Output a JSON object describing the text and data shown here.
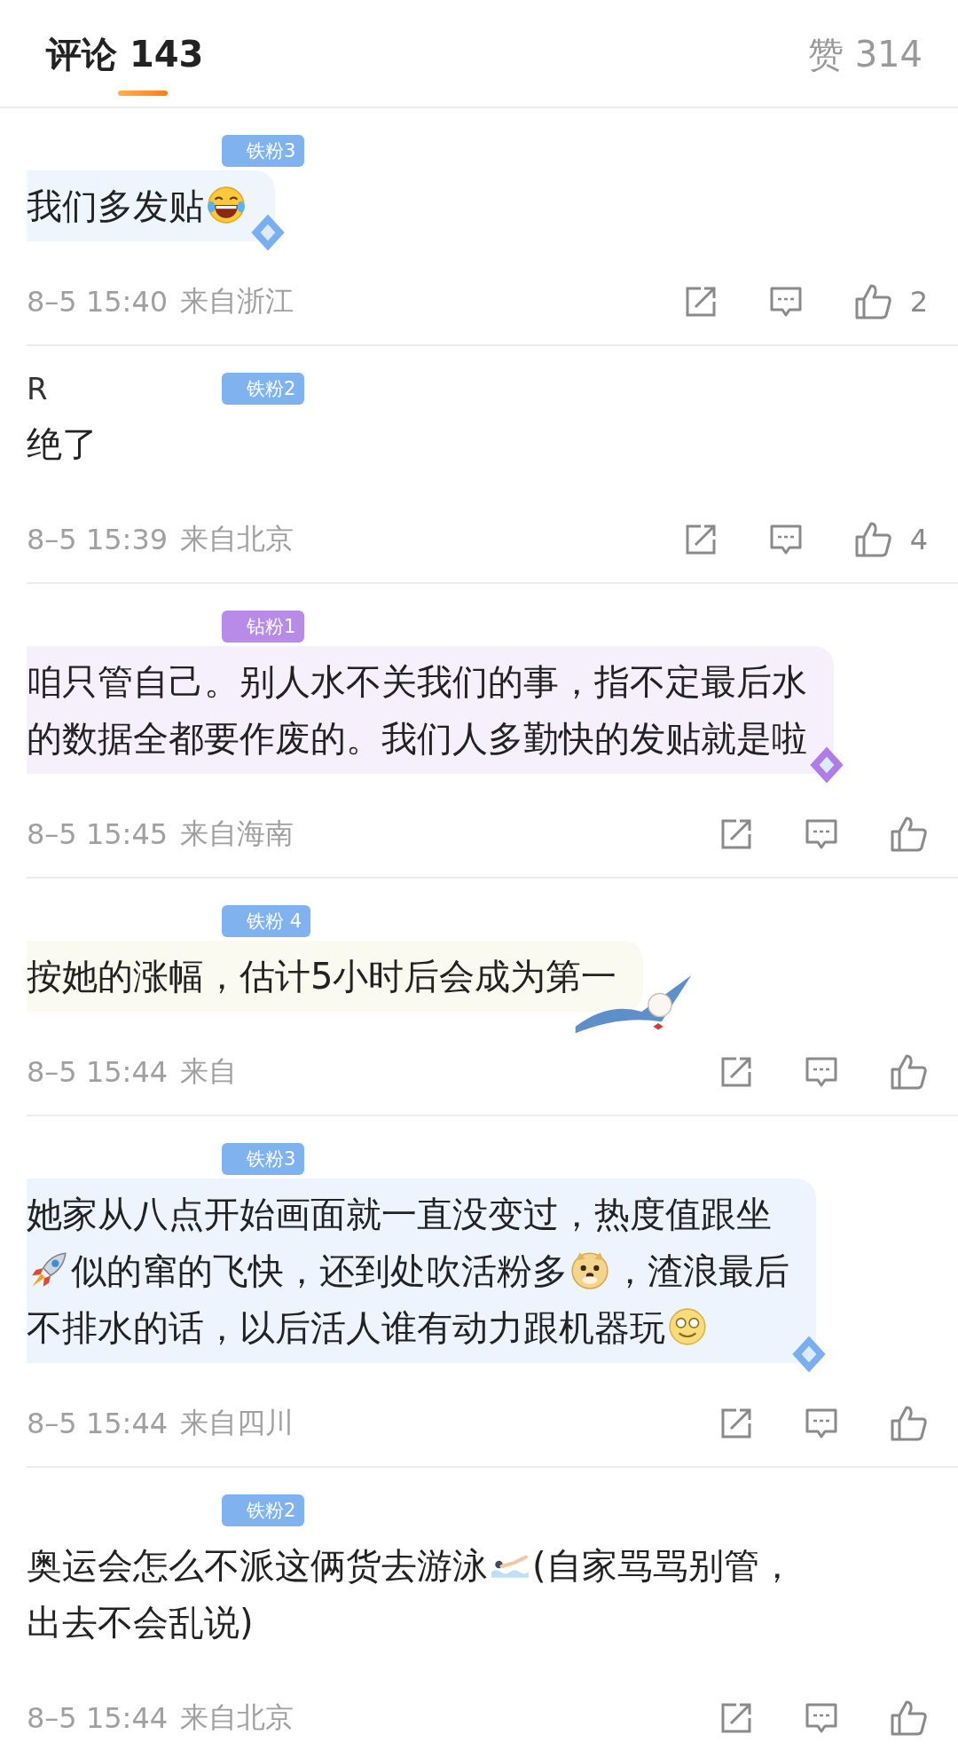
{
  "tabs": [
    {
      "label": "评论 143",
      "selected": true
    },
    {
      "label": "赞 314",
      "selected": false
    }
  ],
  "comments": [
    {
      "badge": {
        "label": "铁粉3",
        "color": "#7fb2ef"
      },
      "bubble": {
        "color": "#eef5fd"
      },
      "ornament": {
        "kind": "diamond",
        "color": "#79aef0"
      },
      "lines": [
        [
          {
            "kind": "text",
            "text": "我们多发贴"
          },
          {
            "kind": "laugh"
          }
        ]
      ],
      "time": "8–5 15:40",
      "location": "来自浙江",
      "likes": "2"
    },
    {
      "user": "R",
      "badge": {
        "label": "铁粉2",
        "color": "#7fb2ef"
      },
      "lines": [
        [
          {
            "kind": "text",
            "text": "绝了"
          }
        ]
      ],
      "time": "8–5 15:39",
      "location": "来自北京",
      "likes": "4"
    },
    {
      "badge": {
        "label": "钻粉1",
        "color": "#b98be8"
      },
      "bubble": {
        "color": "#f5f0fb"
      },
      "ornament": {
        "kind": "diamond",
        "color": "#b07ce8"
      },
      "lines": [
        [
          {
            "kind": "text",
            "text": "咱只管自己。别人水不关我们的事，指不定最后水"
          }
        ],
        [
          {
            "kind": "text",
            "text": "的数据全都要作废的。我们人多勤快的发贴就是啦"
          }
        ]
      ],
      "time": "8–5 15:45",
      "location": "来自海南"
    },
    {
      "badge": {
        "label": "铁粉 4",
        "color": "#7fb2ef"
      },
      "bubble": {
        "color": "#fbfaf0"
      },
      "ornament": {
        "kind": "ribbon",
        "color": "#5f8fc9"
      },
      "lines": [
        [
          {
            "kind": "text",
            "text": "按她的涨幅，估计5小时后会成为第一"
          }
        ]
      ],
      "time": "8–5 15:44",
      "location": "来自"
    },
    {
      "badge": {
        "label": "铁粉3",
        "color": "#7fb2ef"
      },
      "bubble": {
        "color": "#eef4fd"
      },
      "ornament": {
        "kind": "diamond",
        "color": "#79aef0"
      },
      "lines": [
        [
          {
            "kind": "text",
            "text": "她家从八点开始画面就一直没变过，热度值跟坐"
          }
        ],
        [
          {
            "kind": "rocket"
          },
          {
            "kind": "text",
            "text": "似的窜的飞快，还到处吹活粉多"
          },
          {
            "kind": "doge"
          },
          {
            "kind": "text",
            "text": "，渣浪最后"
          }
        ],
        [
          {
            "kind": "text",
            "text": "不排水的话，以后活人谁有动力跟机器玩"
          },
          {
            "kind": "smile"
          }
        ]
      ],
      "time": "8–5 15:44",
      "location": "来自四川"
    },
    {
      "badge": {
        "label": "铁粉2",
        "color": "#7fb2ef"
      },
      "lines": [
        [
          {
            "kind": "text",
            "text": "奥运会怎么不派这俩货去游泳"
          },
          {
            "kind": "swim"
          },
          {
            "kind": "text",
            "text": "(自家骂骂别管，"
          }
        ],
        [
          {
            "kind": "text",
            "text": "出去不会乱说)"
          }
        ]
      ],
      "time": "8–5 15:44",
      "location": "来自北京"
    }
  ]
}
